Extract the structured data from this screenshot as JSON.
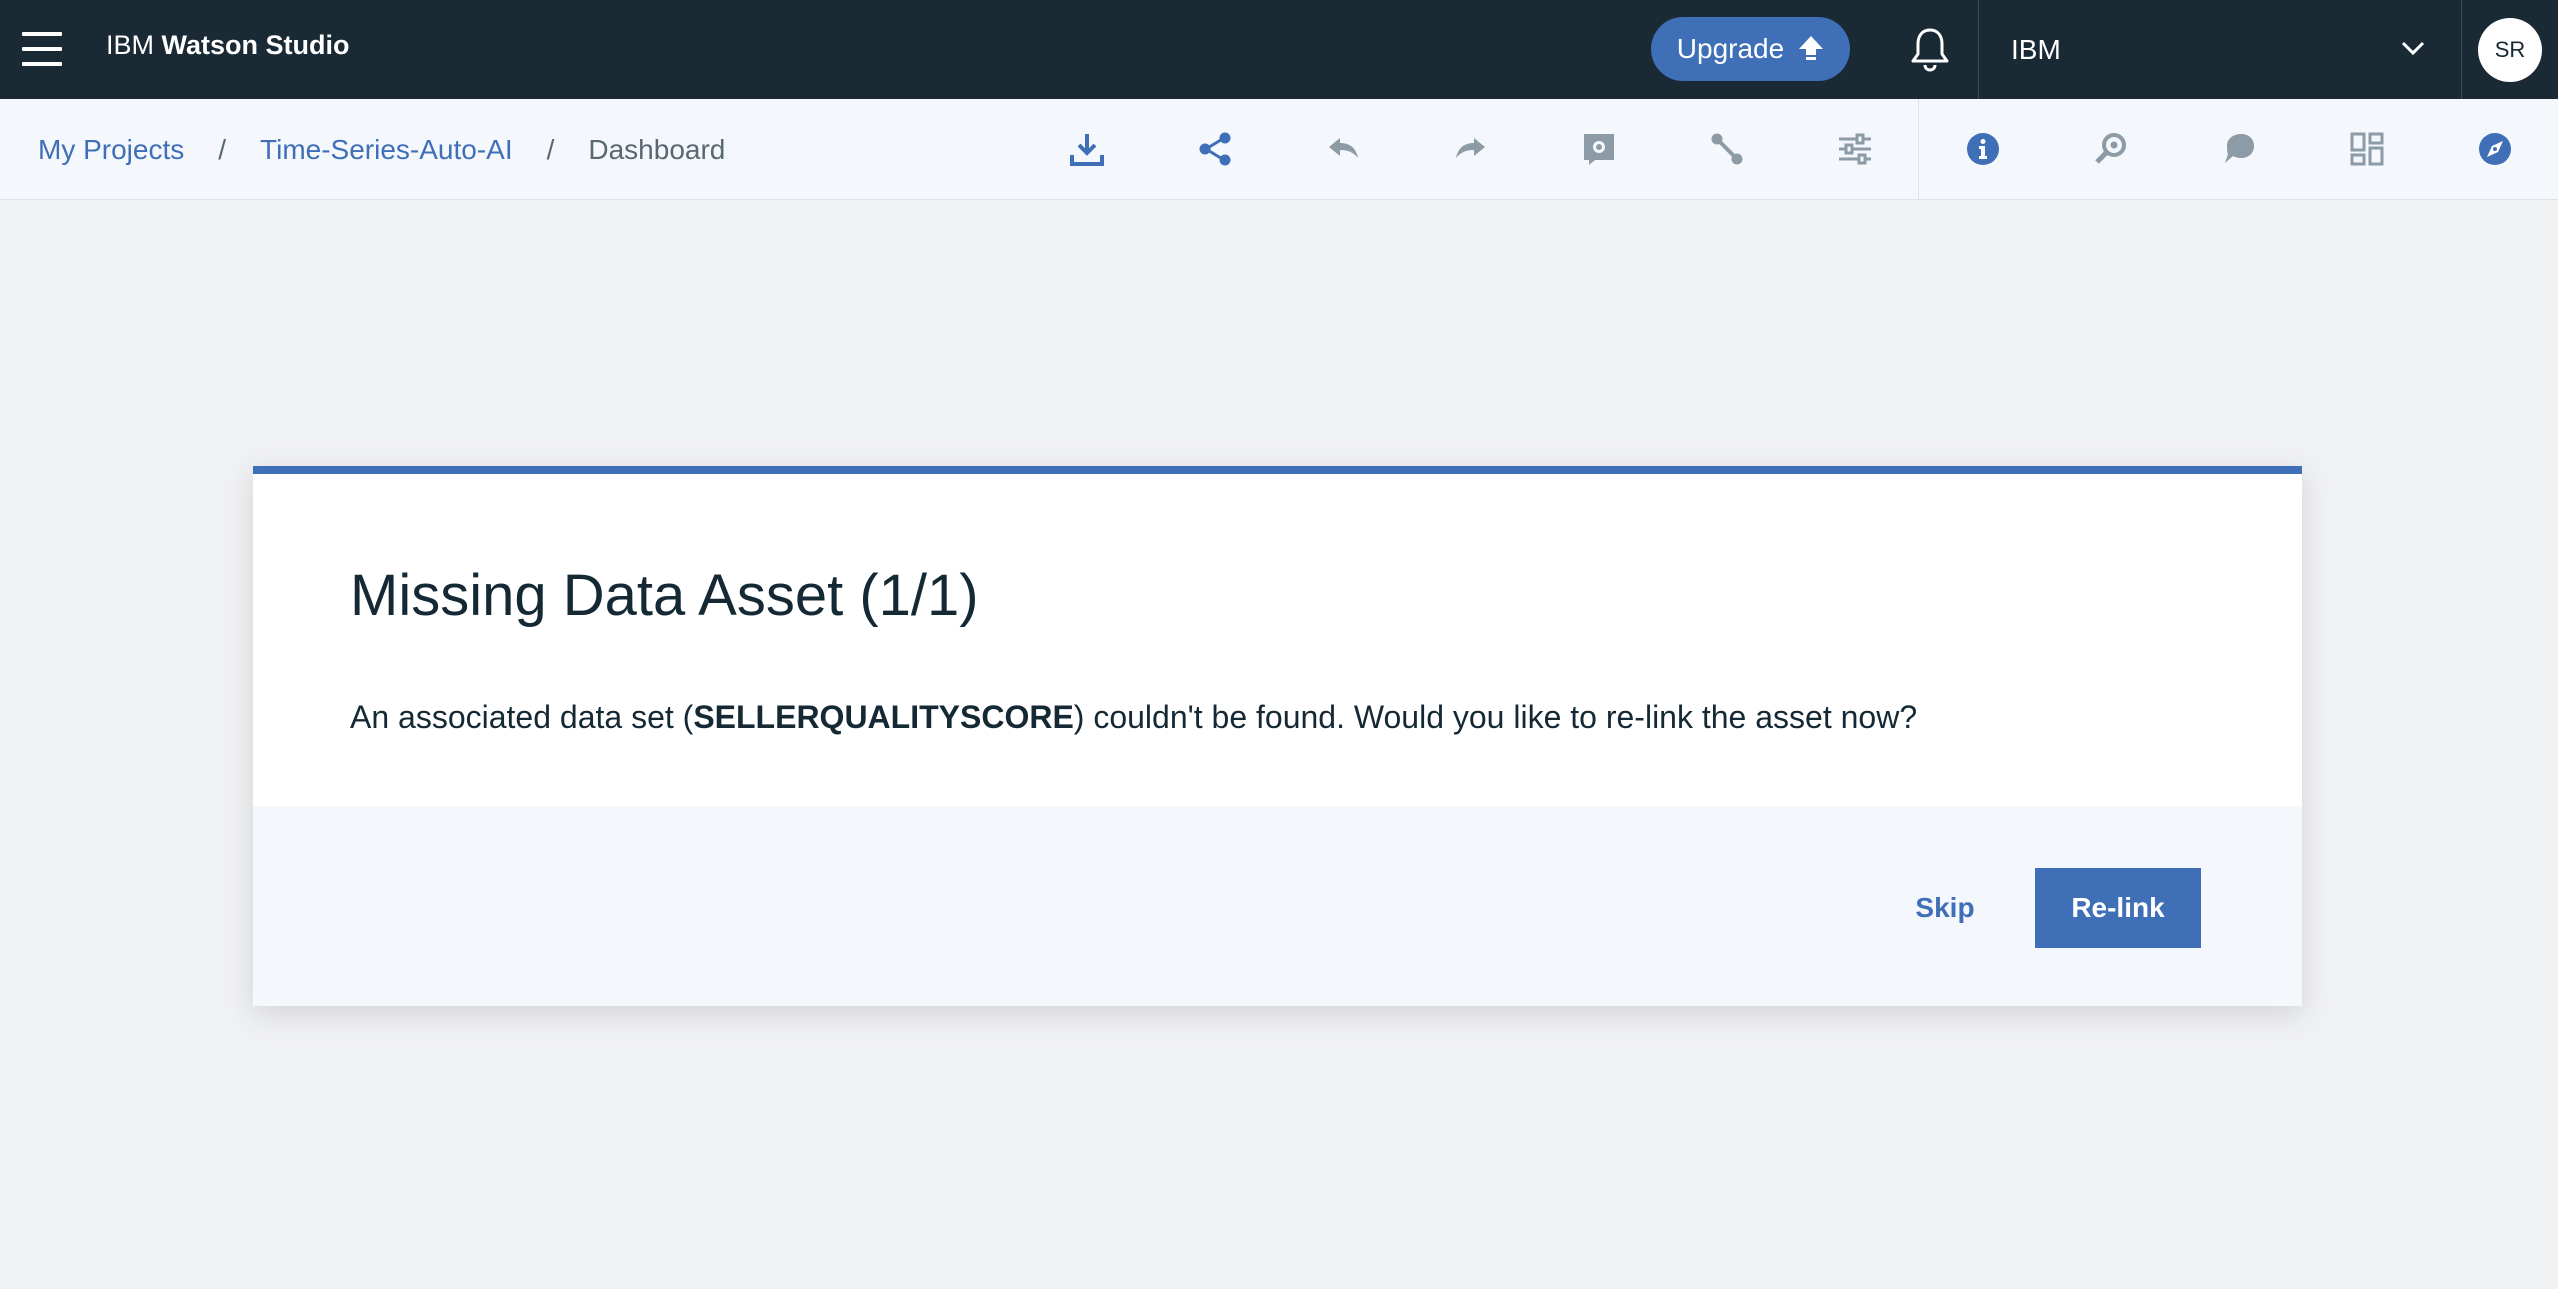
{
  "header": {
    "brand_prefix": "IBM",
    "brand_product": "Watson Studio",
    "upgrade_label": "Upgrade",
    "account_name": "IBM",
    "avatar_initials": "SR"
  },
  "breadcrumb": {
    "items": [
      "My Projects",
      "Time-Series-Auto-AI",
      "Dashboard"
    ],
    "separator": "/"
  },
  "toolbar": {
    "icons": [
      "download-icon",
      "share-icon",
      "undo-icon",
      "redo-icon",
      "notebook-icon",
      "connection-icon",
      "settings-sliders-icon",
      "info-icon",
      "search-asset-icon",
      "comment-icon",
      "dashboard-grid-icon",
      "explore-icon"
    ]
  },
  "modal": {
    "title": "Missing Data Asset (1/1)",
    "body_before": "An associated data set (",
    "body_asset": "SELLERQUALITYSCORE",
    "body_after": ") couldn't be found. Would you like to re-link the asset now?",
    "skip_label": "Skip",
    "relink_label": "Re-link"
  },
  "colors": {
    "header_bg": "#1a2a35",
    "accent": "#3f6fb7",
    "toolbar_bg": "#f4f7fb",
    "page_bg": "#f0f1f3",
    "icon_muted": "#8c9ba5"
  }
}
